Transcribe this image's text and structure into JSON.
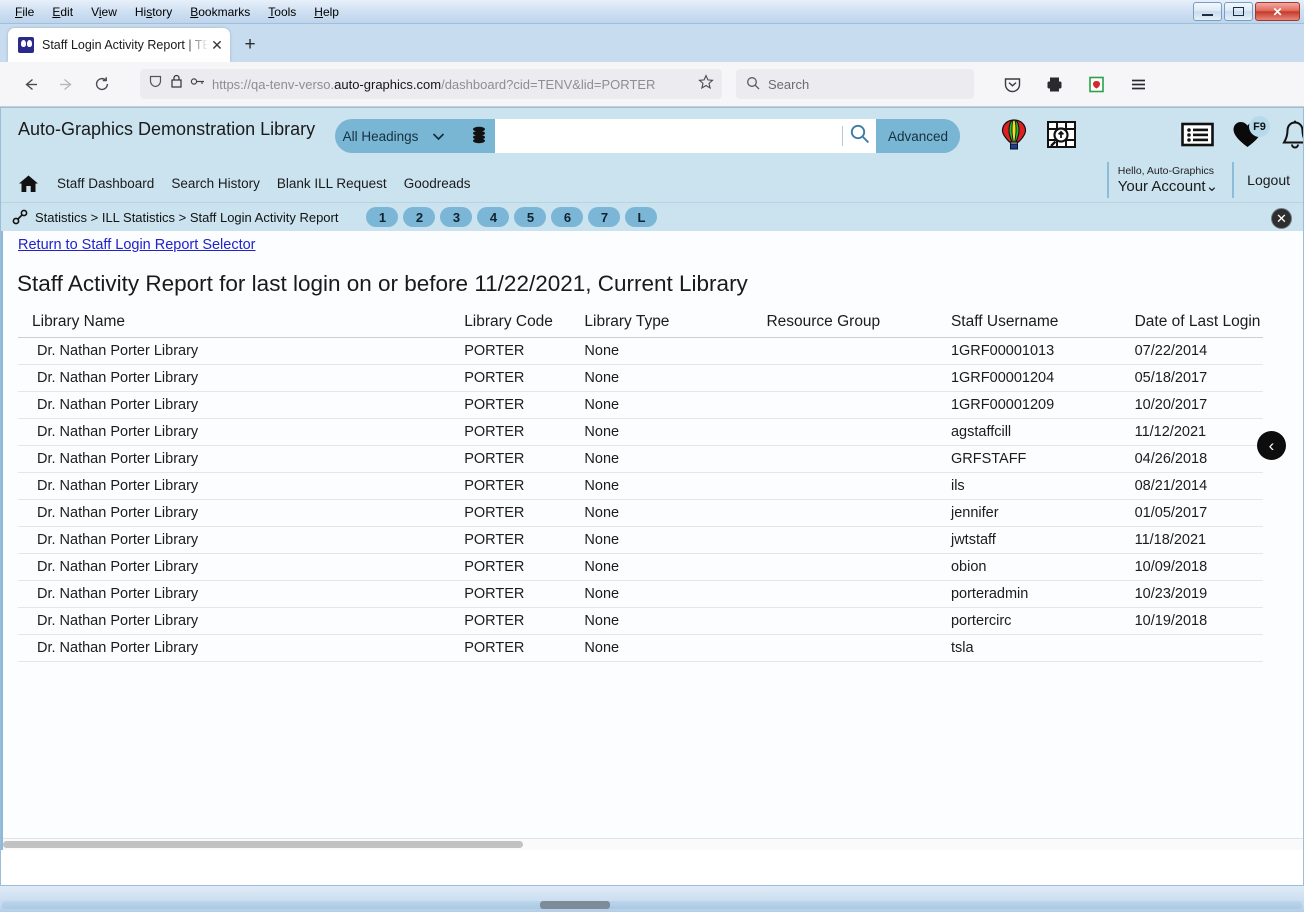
{
  "window": {
    "menus": [
      "File",
      "Edit",
      "View",
      "History",
      "Bookmarks",
      "Tools",
      "Help"
    ],
    "minimize_label": "Minimize",
    "maximize_label": "Maximize",
    "close_label": "✕"
  },
  "browser": {
    "tab_title": "Staff Login Activity Report | TENV",
    "tab_close_label": "✕",
    "new_tab_label": "+",
    "url_prefix": "https://qa-tenv-verso.",
    "url_domain": "auto-graphics.com",
    "url_suffix": "/dashboard?cid=TENV&lid=PORTER",
    "search_placeholder": "Search"
  },
  "app": {
    "title": "Auto-Graphics Demonstration Library",
    "search": {
      "scope": "All Headings",
      "query": "",
      "advanced_label": "Advanced"
    },
    "nav": [
      "Staff Dashboard",
      "Search History",
      "Blank ILL Request",
      "Goodreads"
    ],
    "account": {
      "hello": "Hello, Auto-Graphics",
      "name": "Your Account",
      "logout": "Logout"
    },
    "favorites_badge": "F9"
  },
  "breadcrumb": {
    "text": "Statistics > ILL Statistics > Staff Login Activity Report",
    "pages": [
      "1",
      "2",
      "3",
      "4",
      "5",
      "6",
      "7",
      "L"
    ],
    "close_label": "✕"
  },
  "content": {
    "return_link": "Return to Staff Login Report Selector",
    "report_title": "Staff Activity Report for last login on or before 11/22/2021, Current Library",
    "back_label": "‹",
    "table": {
      "headers": [
        "Library Name",
        "Library Code",
        "Library Type",
        "Resource Group",
        "Staff Username",
        "Date of Last Login"
      ],
      "rows": [
        {
          "name": "Dr. Nathan Porter Library",
          "code": "PORTER",
          "type": "None",
          "rg": "",
          "user": "1GRF00001013",
          "date": "07/22/2014"
        },
        {
          "name": "Dr. Nathan Porter Library",
          "code": "PORTER",
          "type": "None",
          "rg": "",
          "user": "1GRF00001204",
          "date": "05/18/2017"
        },
        {
          "name": "Dr. Nathan Porter Library",
          "code": "PORTER",
          "type": "None",
          "rg": "",
          "user": "1GRF00001209",
          "date": "10/20/2017"
        },
        {
          "name": "Dr. Nathan Porter Library",
          "code": "PORTER",
          "type": "None",
          "rg": "",
          "user": "agstaffcill",
          "date": "11/12/2021"
        },
        {
          "name": "Dr. Nathan Porter Library",
          "code": "PORTER",
          "type": "None",
          "rg": "",
          "user": "GRFSTAFF",
          "date": "04/26/2018"
        },
        {
          "name": "Dr. Nathan Porter Library",
          "code": "PORTER",
          "type": "None",
          "rg": "",
          "user": "ils",
          "date": "08/21/2014"
        },
        {
          "name": "Dr. Nathan Porter Library",
          "code": "PORTER",
          "type": "None",
          "rg": "",
          "user": "jennifer",
          "date": "01/05/2017"
        },
        {
          "name": "Dr. Nathan Porter Library",
          "code": "PORTER",
          "type": "None",
          "rg": "",
          "user": "jwtstaff",
          "date": "11/18/2021"
        },
        {
          "name": "Dr. Nathan Porter Library",
          "code": "PORTER",
          "type": "None",
          "rg": "",
          "user": "obion",
          "date": "10/09/2018"
        },
        {
          "name": "Dr. Nathan Porter Library",
          "code": "PORTER",
          "type": "None",
          "rg": "",
          "user": "porteradmin",
          "date": "10/23/2019"
        },
        {
          "name": "Dr. Nathan Porter Library",
          "code": "PORTER",
          "type": "None",
          "rg": "",
          "user": "portercirc",
          "date": "10/19/2018"
        },
        {
          "name": "Dr. Nathan Porter Library",
          "code": "PORTER",
          "type": "None",
          "rg": "",
          "user": "tsla",
          "date": ""
        }
      ]
    }
  },
  "colors": {
    "app_header_bg": "#cbe3ef",
    "accent_blue": "#79b6d4",
    "link_blue": "#2222cc"
  }
}
